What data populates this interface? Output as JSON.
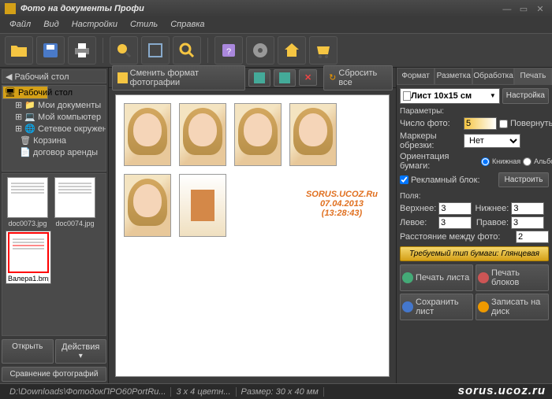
{
  "title": "Фото на документы Профи",
  "menu": [
    "Файл",
    "Вид",
    "Настройки",
    "Стиль",
    "Справка"
  ],
  "crumb": "Рабочий стол",
  "tree": [
    {
      "label": "Рабочий стол",
      "indent": 0,
      "sel": true
    },
    {
      "label": "Мои документы",
      "indent": 1
    },
    {
      "label": "Мой компьютер",
      "indent": 1
    },
    {
      "label": "Сетевое окружение",
      "indent": 1
    },
    {
      "label": "Корзина",
      "indent": 1
    },
    {
      "label": "договор аренды",
      "indent": 1
    }
  ],
  "thumbs": [
    {
      "label": "doc0073.jpg",
      "sel": false
    },
    {
      "label": "doc0074.jpg",
      "sel": false
    },
    {
      "label": "Валера1.bmp",
      "sel": true
    }
  ],
  "leftbtns": {
    "open": "Открыть",
    "actions": "Действия",
    "compare": "Сравнение фотографий"
  },
  "editbar": {
    "changefmt": "Сменить формат фотографии",
    "reset": "Сбросить все"
  },
  "watermark": {
    "l1": "SORUS.UCOZ.Ru",
    "l2": "07.04.2013",
    "l3": "(13:28:43)"
  },
  "tabs": [
    "Формат",
    "Разметка",
    "Обработка",
    "Печать"
  ],
  "sheet": "Лист 10x15 см",
  "configbtn": "Настройка",
  "params_hdr": "Параметры:",
  "p": {
    "count_lbl": "Число фото:",
    "count": "5",
    "rotate": "Повернуть",
    "crop_lbl": "Маркеры обрезки:",
    "crop": "Нет",
    "orient_lbl": "Ориентация бумаги:",
    "orient_a": "Книжная",
    "orient_b": "Альбомная",
    "ad_lbl": "Рекламный блок:",
    "ad_btn": "Настроить"
  },
  "margins_hdr": "Поля:",
  "m": {
    "top_lbl": "Верхнее:",
    "top": "3",
    "bottom_lbl": "Нижнее:",
    "bottom": "3",
    "left_lbl": "Левое:",
    "left": "3",
    "right_lbl": "Правое:",
    "right": "3",
    "gap_lbl": "Расстояние между фото:",
    "gap": "2"
  },
  "paper": "Требуемый тип бумаги: Глянцевая",
  "actions": {
    "a1": "Печать листа",
    "a2": "Печать блоков",
    "a3": "Сохранить лист",
    "a4": "Записать на диск"
  },
  "status": {
    "path": "D:\\Downloads\\ФотодокПРО60PortRu...",
    "mode": "3 x 4 цветн...",
    "size": "Размер: 30 x 40 мм"
  },
  "brand": "sorus.ucoz.ru"
}
